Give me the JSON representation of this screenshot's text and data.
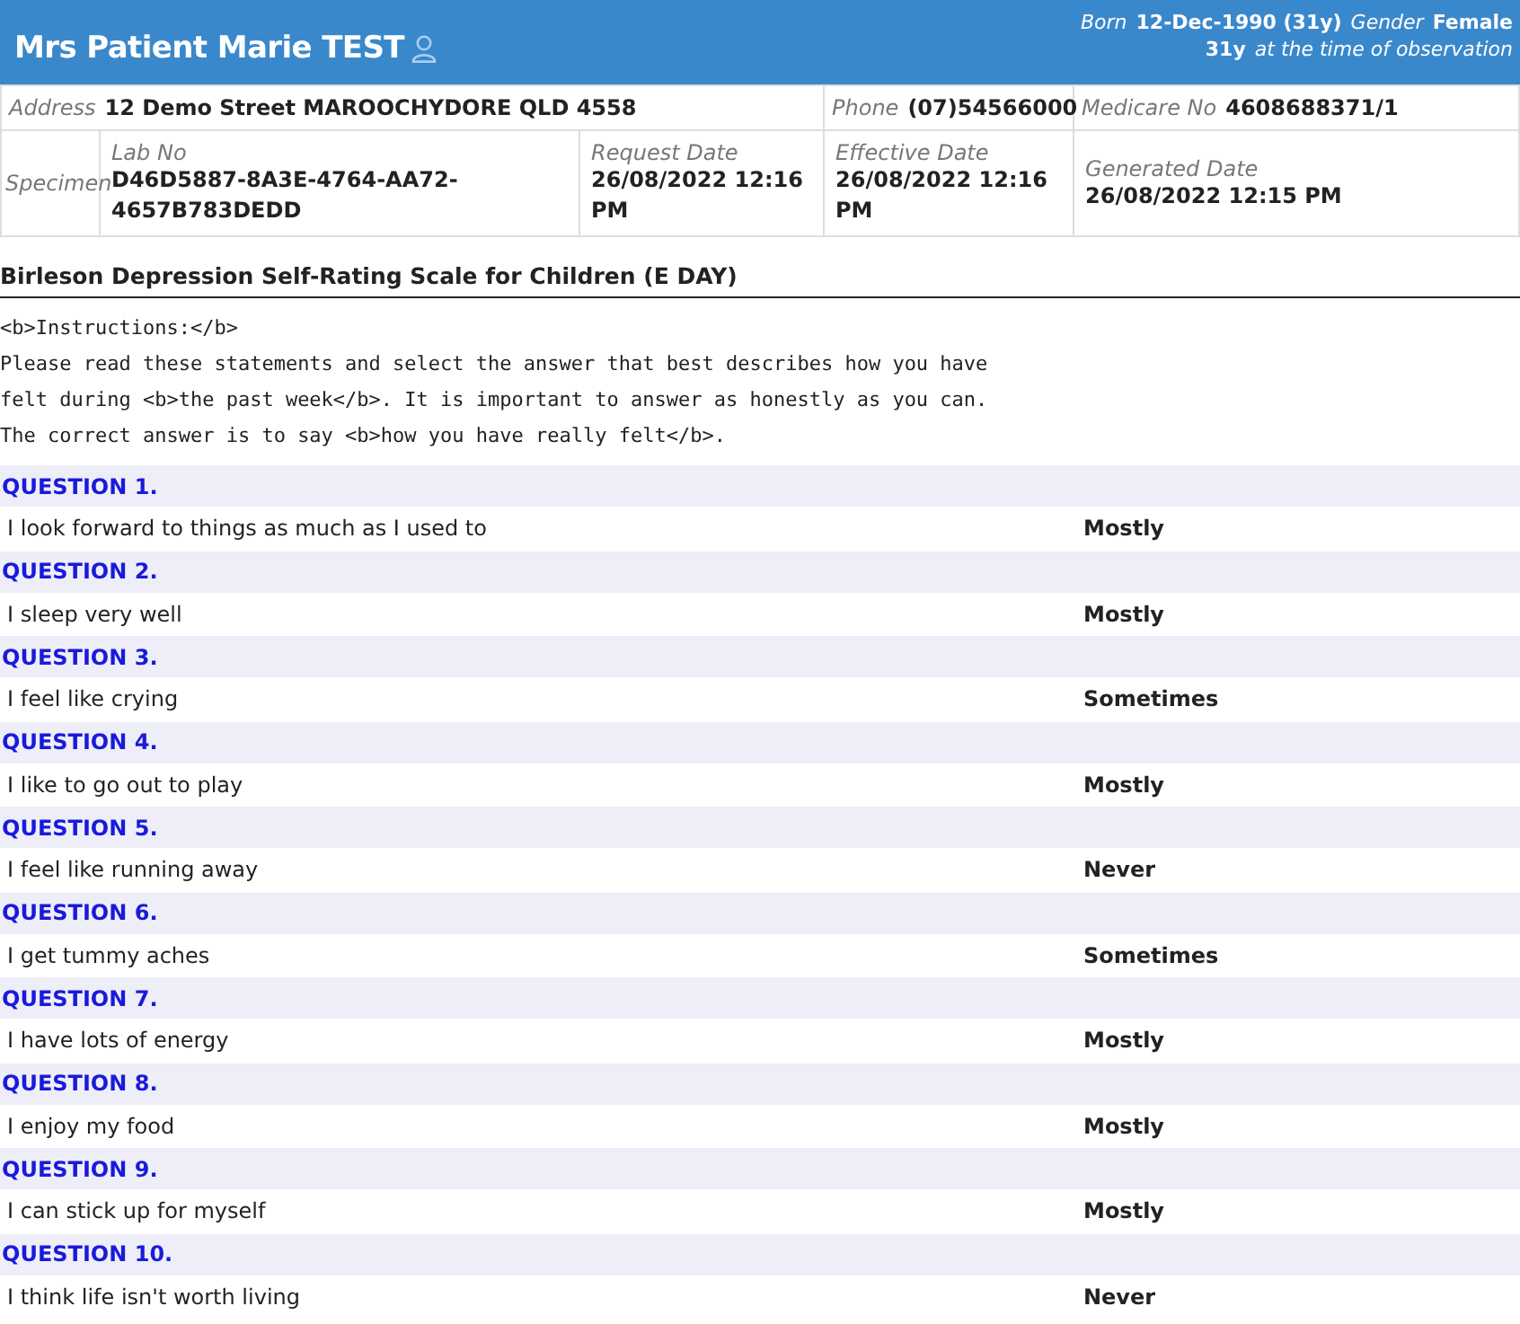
{
  "header": {
    "patient_name": "Mrs Patient Marie TEST",
    "born_label": "Born",
    "born_value": "12-Dec-1990 (31y)",
    "gender_label": "Gender",
    "gender_value": "Female",
    "age_value": "31y",
    "age_note": "at the time of observation"
  },
  "details": {
    "address_label": "Address",
    "address": "12 Demo Street MAROOCHYDORE QLD 4558",
    "phone_label": "Phone",
    "phone": "(07)54566000",
    "medicare_label": "Medicare No",
    "medicare": "4608688371/1",
    "specimen_label": "Specimen",
    "fields": [
      {
        "label": "Lab No",
        "value": "D46D5887-8A3E-4764-AA72-4657B783DEDD"
      },
      {
        "label": "Request Date",
        "value": "26/08/2022 12:16 PM"
      },
      {
        "label": "Effective Date",
        "value": "26/08/2022 12:16 PM"
      },
      {
        "label": "Generated Date",
        "value": "26/08/2022 12:15 PM"
      }
    ]
  },
  "report_title": "Birleson Depression Self-Rating Scale for Children (E DAY)",
  "instructions": [
    "<b>Instructions:</b>",
    "Please read these statements and select the answer that best describes how you have",
    "felt during <b>the past week</b>. It is important to answer as honestly as you can.",
    "The correct answer is to say <b>how you have really felt</b>."
  ],
  "questions": [
    {
      "heading": "QUESTION 1.",
      "statement": "I look forward to things as much as I used to",
      "answer": "Mostly"
    },
    {
      "heading": "QUESTION 2.",
      "statement": "I sleep very well",
      "answer": "Mostly"
    },
    {
      "heading": "QUESTION 3.",
      "statement": "I feel like crying",
      "answer": "Sometimes"
    },
    {
      "heading": "QUESTION 4.",
      "statement": "I like to go out to play",
      "answer": "Mostly"
    },
    {
      "heading": "QUESTION 5.",
      "statement": "I feel like running away",
      "answer": "Never"
    },
    {
      "heading": "QUESTION 6.",
      "statement": "I get tummy aches",
      "answer": "Sometimes"
    },
    {
      "heading": "QUESTION 7.",
      "statement": "I have lots of energy",
      "answer": "Mostly"
    },
    {
      "heading": "QUESTION 8.",
      "statement": "I enjoy my food",
      "answer": "Mostly"
    },
    {
      "heading": "QUESTION 9.",
      "statement": "I can stick up for myself",
      "answer": "Mostly"
    },
    {
      "heading": "QUESTION 10.",
      "statement": "I think life isn't worth living",
      "answer": "Never"
    }
  ]
}
